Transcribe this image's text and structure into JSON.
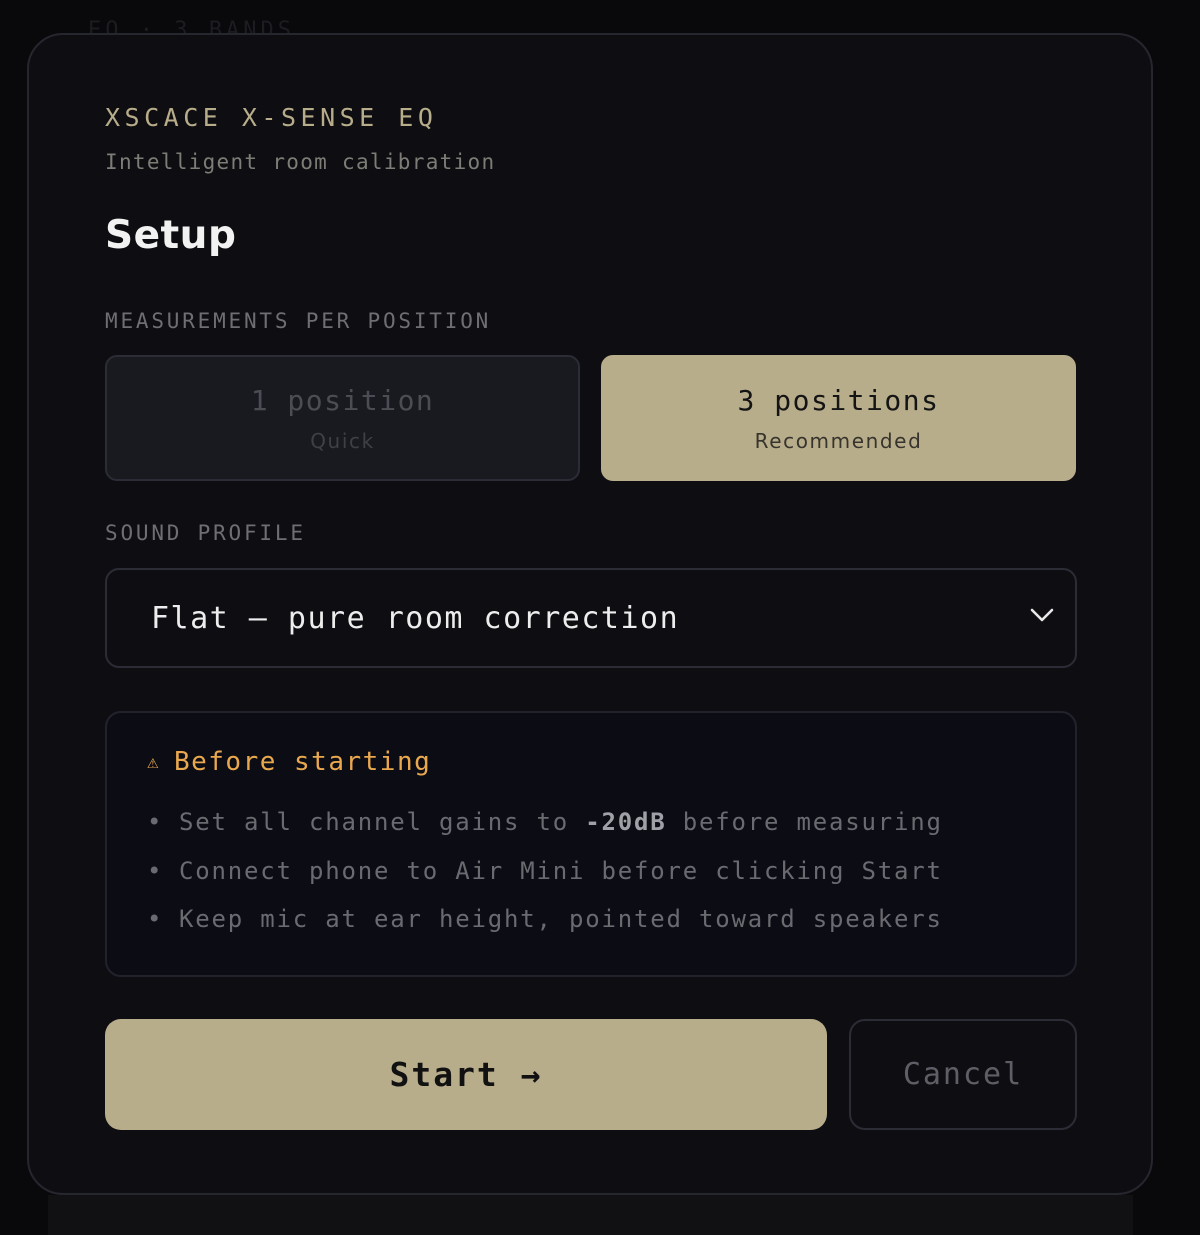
{
  "backdrop": {
    "behind_text": "EQ · 3 BANDS"
  },
  "modal": {
    "brand": "XSCACE X-SENSE EQ",
    "subtitle": "Intelligent room calibration",
    "heading": "Setup"
  },
  "measurements": {
    "label": "MEASUREMENTS PER POSITION",
    "options": [
      {
        "main": "1 position",
        "sub": "Quick",
        "selected": false
      },
      {
        "main": "3 positions",
        "sub": "Recommended",
        "selected": true
      }
    ]
  },
  "sound_profile": {
    "label": "SOUND PROFILE",
    "selected": "Flat — pure room correction",
    "icon": "chevron-down-icon"
  },
  "notice": {
    "icon": "warning-icon",
    "title": "Before starting",
    "items": [
      {
        "pre": "Set all channel gains to ",
        "strong": "-20dB",
        "post": " before measuring"
      },
      {
        "pre": "Connect phone to Air Mini before clicking Start",
        "strong": "",
        "post": ""
      },
      {
        "pre": "Keep mic at ear height, pointed toward speakers",
        "strong": "",
        "post": ""
      }
    ],
    "bullet": "•"
  },
  "actions": {
    "start_label": "Start →",
    "cancel_label": "Cancel"
  },
  "colors": {
    "accent": "#b8ad8b",
    "warning": "#e9a84e",
    "panel": "#0e0e12"
  }
}
